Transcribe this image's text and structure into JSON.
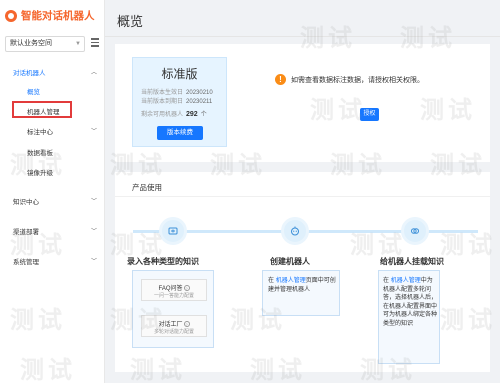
{
  "brand": {
    "title": "智能对话机器人"
  },
  "space_select": {
    "value": "默认业务空间"
  },
  "nav": {
    "group_robot": "对话机器人",
    "overview": "概览",
    "robot_manage": "机器人管理",
    "label_center": "标注中心",
    "data_report": "数据看板",
    "image_upgrade": "镜像升级",
    "knowledge_center": "知识中心",
    "channel_deploy": "渠道部署",
    "system_manage": "系统管理"
  },
  "page": {
    "title": "概览"
  },
  "version": {
    "name": "标准版",
    "effective_label": "当前版本生效日",
    "effective_value": "20230210",
    "expire_label": "当前版本到期日",
    "expire_value": "20230211",
    "remaining_label": "剩余可用机器人",
    "remaining_value": "292",
    "remaining_unit": "个",
    "renew_button": "版本续费"
  },
  "notice": {
    "text": "如需查看数据标注数据，请授权相关权限。",
    "button": "授权"
  },
  "usage": {
    "title": "产品使用",
    "step1": {
      "title": "录入各种类型的知识",
      "item1_title": "FAQ问答",
      "item1_desc": "一问一答能力配置",
      "item2_title": "对话工厂",
      "item2_desc": "多轮对话能力配置"
    },
    "step2": {
      "title": "创建机器人",
      "text_pre": "在",
      "link": "机器人管理",
      "text_post": "页面中可创建并管理机器人"
    },
    "step3": {
      "title": "给机器人挂载知识",
      "text_pre": "在",
      "link": "机器人管理",
      "text_post": "中为机器人配置多轮问答，选择机器人后，在机器人配置界面中可为机器人绑定各种类型的知识"
    }
  },
  "watermark": "测试",
  "colors": {
    "accent": "#1677ff",
    "brand": "#f5662d",
    "highlight": "#e23b3b"
  }
}
